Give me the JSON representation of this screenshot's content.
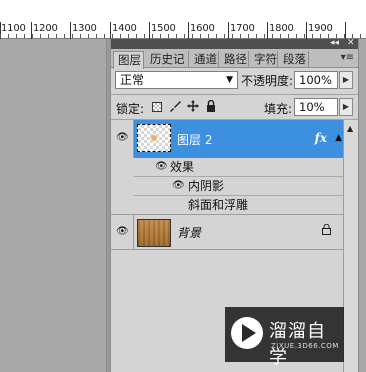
{
  "ruler": {
    "labels": [
      "1100",
      "1200",
      "1300",
      "1400",
      "1500",
      "1600",
      "1700",
      "1800",
      "1900"
    ]
  },
  "panel": {
    "titlebar": {
      "collapse": "◂◂",
      "close": "✕"
    },
    "tabs": [
      "图层",
      "历史记",
      "通道",
      "路径",
      "字符",
      "段落"
    ],
    "menu_icon": "▾≡",
    "blend_mode": "正常",
    "opacity_label": "不透明度:",
    "opacity_value": "100%",
    "lock_label": "锁定:",
    "fill_label": "填充:",
    "fill_value": "10%",
    "layers": [
      {
        "name": "图层 2",
        "fx": "fx",
        "selected": true
      },
      {
        "name": "背景",
        "locked": true
      }
    ],
    "effects": {
      "group": "效果",
      "items": [
        "内阴影",
        "斜面和浮雕"
      ]
    }
  },
  "watermark": {
    "title": "溜溜自学",
    "url": "ZIXUE.3D66.COM"
  },
  "colors": {
    "selection": "#3d8fe0",
    "panel": "#d4d4d4",
    "tab_bar": "#bdbdbd"
  },
  "icons": [
    "eye-icon",
    "lock-icon",
    "brush-icon",
    "move-icon",
    "fx-icon",
    "flyout-arrow-icon"
  ]
}
